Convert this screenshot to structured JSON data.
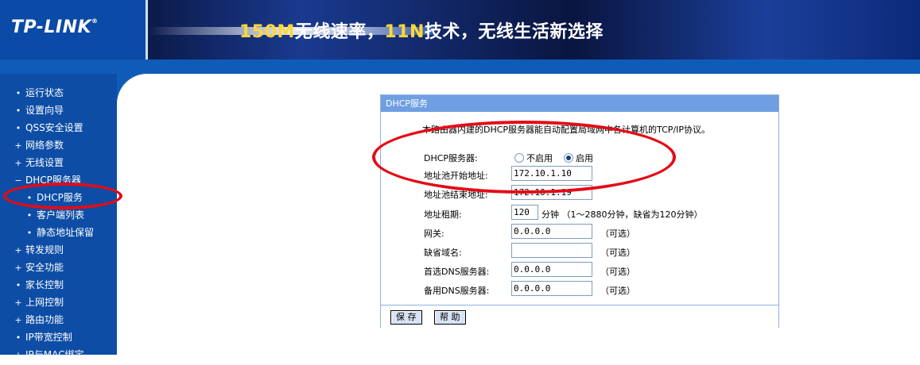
{
  "header": {
    "logo": "TP-LINK",
    "logo_mark": "®",
    "slogan_parts": [
      "150M",
      "无线速率，",
      "11N",
      "技术，无线生活新选择"
    ]
  },
  "sidebar": {
    "items": [
      {
        "marker": "•",
        "label": "运行状态"
      },
      {
        "marker": "•",
        "label": "设置向导"
      },
      {
        "marker": "•",
        "label": "QSS安全设置"
      },
      {
        "marker": "+",
        "label": "网络参数"
      },
      {
        "marker": "+",
        "label": "无线设置"
      },
      {
        "marker": "−",
        "label": "DHCP服务器"
      },
      {
        "marker": "•",
        "label": "DHCP服务"
      },
      {
        "marker": "•",
        "label": "客户端列表"
      },
      {
        "marker": "•",
        "label": "静态地址保留"
      },
      {
        "marker": "+",
        "label": "转发规则"
      },
      {
        "marker": "+",
        "label": "安全功能"
      },
      {
        "marker": "•",
        "label": "家长控制"
      },
      {
        "marker": "+",
        "label": "上网控制"
      },
      {
        "marker": "+",
        "label": "路由功能"
      },
      {
        "marker": "•",
        "label": "IP带宽控制"
      },
      {
        "marker": "+",
        "label": "IP与MAC绑定"
      }
    ]
  },
  "panel": {
    "title": "DHCP服务",
    "description": "本路由器内建的DHCP服务器能自动配置局域网中各计算机的TCP/IP协议。",
    "dhcp_server_label": "DHCP服务器:",
    "disable_label": "不启用",
    "enable_label": "启用",
    "enabled": true,
    "start_label": "地址池开始地址:",
    "start_value": "172.10.1.10",
    "end_label": "地址池结束地址:",
    "end_value": "172.10.1.19",
    "lease_label": "地址租期:",
    "lease_value": "120",
    "lease_unit": "分钟",
    "lease_hint": "（1～2880分钟，缺省为120分钟）",
    "gateway_label": "网关:",
    "gateway_value": "0.0.0.0",
    "domain_label": "缺省域名:",
    "domain_value": "",
    "dns1_label": "首选DNS服务器:",
    "dns1_value": "0.0.0.0",
    "dns2_label": "备用DNS服务器:",
    "dns2_value": "0.0.0.0",
    "optional": "（可选）",
    "save_label": "保 存",
    "help_label": "帮 助"
  }
}
